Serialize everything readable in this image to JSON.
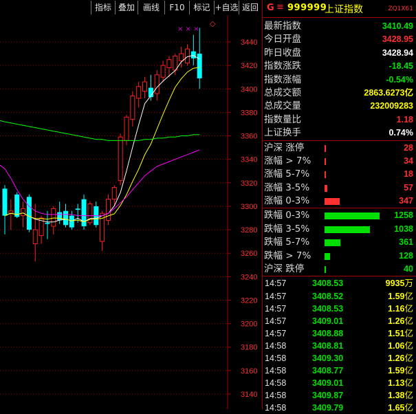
{
  "toolbar": {
    "buttons": [
      "指标",
      "叠加",
      "画线",
      "F10",
      "标记",
      "+自选",
      "返回"
    ]
  },
  "chart": {
    "markers": "× × ×",
    "diamond": "◇",
    "y_labels": [
      "3440",
      "3420",
      "3400",
      "3380",
      "3360",
      "3340",
      "3320",
      "3300",
      "3280",
      "3260",
      "3240",
      "3220",
      "3200",
      "3180",
      "3160",
      "3140"
    ],
    "colors": {
      "up": "#ff2020",
      "down": "#00ffff",
      "ma5": "#ffffff",
      "ma10": "#ffff00",
      "ma20": "#ff00ff",
      "ma60": "#00ff00",
      "grid": "#a00000",
      "axis_text": "#ff3030"
    }
  },
  "chart_data": {
    "type": "candlestick",
    "ylim": [
      3130,
      3460
    ],
    "candles": [
      [
        3315,
        3318,
        3276,
        3292
      ],
      [
        3294,
        3306,
        3280,
        3296
      ],
      [
        3310,
        3312,
        3290,
        3291
      ],
      [
        3292,
        3304,
        3282,
        3298
      ],
      [
        3308,
        3310,
        3278,
        3280
      ],
      [
        3268,
        3302,
        3253,
        3280
      ],
      [
        3275,
        3292,
        3268,
        3290
      ],
      [
        3286,
        3296,
        3272,
        3285
      ],
      [
        3283,
        3300,
        3276,
        3298
      ],
      [
        3295,
        3304,
        3285,
        3288
      ],
      [
        3296,
        3302,
        3282,
        3284
      ],
      [
        3292,
        3296,
        3280,
        3282
      ],
      [
        3298,
        3302,
        3286,
        3297
      ],
      [
        3306,
        3310,
        3280,
        3283
      ],
      [
        3286,
        3304,
        3284,
        3302
      ],
      [
        3300,
        3304,
        3282,
        3284
      ],
      [
        3270,
        3296,
        3262,
        3294
      ],
      [
        3288,
        3310,
        3284,
        3306
      ],
      [
        3306,
        3318,
        3300,
        3316
      ],
      [
        3322,
        3362,
        3318,
        3359
      ],
      [
        3356,
        3378,
        3352,
        3376
      ],
      [
        3374,
        3398,
        3368,
        3394
      ],
      [
        3392,
        3406,
        3384,
        3402
      ],
      [
        3398,
        3410,
        3392,
        3406
      ],
      [
        3401,
        3412,
        3390,
        3393
      ],
      [
        3396,
        3416,
        3390,
        3412
      ],
      [
        3410,
        3424,
        3406,
        3420
      ],
      [
        3418,
        3428,
        3410,
        3425
      ],
      [
        3416,
        3430,
        3412,
        3428
      ],
      [
        3424,
        3436,
        3418,
        3430
      ],
      [
        3422,
        3438,
        3420,
        3434
      ],
      [
        3432,
        3446,
        3420,
        3426
      ],
      [
        3430,
        3452,
        3400,
        3409
      ]
    ]
  },
  "quote": {
    "g": "G",
    "menu": "≡",
    "code": "999999",
    "name": "上证指数",
    "tag": "ZQ1X61",
    "items": [
      {
        "label": "最新指数",
        "value": "3410.49",
        "color": "#00e000"
      },
      {
        "label": "今日开盘",
        "value": "3428.95",
        "color": "#ff3030"
      },
      {
        "label": "昨日收盘",
        "value": "3428.94",
        "color": "#ffffff"
      },
      {
        "label": "指数涨跌",
        "value": "-18.45",
        "color": "#00e000"
      },
      {
        "label": "指数涨幅",
        "value": "-0.54%",
        "color": "#00e000"
      },
      {
        "label": "总成交额",
        "value": "2863.6273亿",
        "color": "#ffff00"
      },
      {
        "label": "总成交量",
        "value": "232009283",
        "color": "#ffff00"
      },
      {
        "label": "指数量比",
        "value": "1.18",
        "color": "#ff3030"
      },
      {
        "label": "上证换手",
        "value": "0.74%",
        "color": "#ffffff"
      }
    ]
  },
  "distribution": {
    "up": [
      {
        "label": "沪深 涨停",
        "count": "28",
        "bar": 0.02,
        "color": "#ff3030"
      },
      {
        "label": "涨幅 > 7%",
        "count": "34",
        "bar": 0.025,
        "color": "#ff3030"
      },
      {
        "label": "涨幅 5-7%",
        "count": "18",
        "bar": 0.015,
        "color": "#ff3030"
      },
      {
        "label": "涨幅 3-5%",
        "count": "57",
        "bar": 0.05,
        "color": "#ff3030"
      },
      {
        "label": "涨幅 0-3%",
        "count": "347",
        "bar": 0.28,
        "color": "#ff3030"
      }
    ],
    "down": [
      {
        "label": "跌幅 0-3%",
        "count": "1258",
        "bar": 1.0,
        "color": "#00e000"
      },
      {
        "label": "跌幅 3-5%",
        "count": "1038",
        "bar": 0.83,
        "color": "#00e000"
      },
      {
        "label": "跌幅 5-7%",
        "count": "361",
        "bar": 0.29,
        "color": "#00e000"
      },
      {
        "label": "跌幅 > 7%",
        "count": "128",
        "bar": 0.1,
        "color": "#00e000"
      },
      {
        "label": "沪深 跌停",
        "count": "40",
        "bar": 0.0,
        "color": "#00e000"
      }
    ]
  },
  "ticks": [
    {
      "time": "14:57",
      "price": "3408.53",
      "vol": "9935",
      "unit": "万"
    },
    {
      "time": "14:57",
      "price": "3408.52",
      "vol": "1.59",
      "unit": "亿"
    },
    {
      "time": "14:57",
      "price": "3408.53",
      "vol": "1.16",
      "unit": "亿"
    },
    {
      "time": "14:57",
      "price": "3409.01",
      "vol": "1.26",
      "unit": "亿"
    },
    {
      "time": "14:57",
      "price": "3408.88",
      "vol": "1.51",
      "unit": "亿"
    },
    {
      "time": "14:58",
      "price": "3408.81",
      "vol": "1.06",
      "unit": "亿"
    },
    {
      "time": "14:58",
      "price": "3409.30",
      "vol": "1.26",
      "unit": "亿"
    },
    {
      "time": "14:58",
      "price": "3408.77",
      "vol": "1.59",
      "unit": "亿"
    },
    {
      "time": "14:58",
      "price": "3409.01",
      "vol": "1.13",
      "unit": "亿"
    },
    {
      "time": "14:58",
      "price": "3409.87",
      "vol": "1.38",
      "unit": "亿"
    },
    {
      "time": "14:58",
      "price": "3409.79",
      "vol": "1.65",
      "unit": "亿"
    }
  ]
}
